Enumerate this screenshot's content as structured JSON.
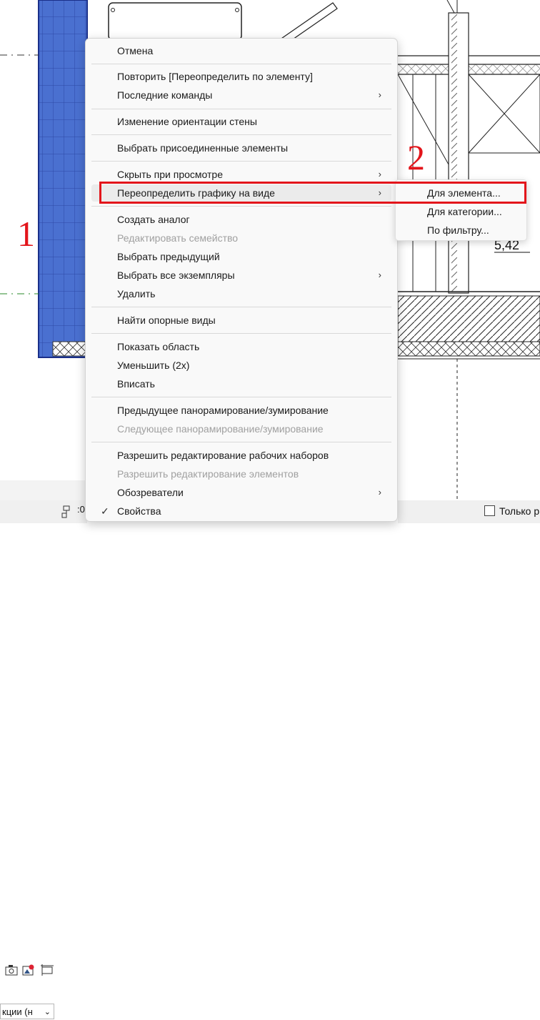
{
  "context_menu": {
    "items": [
      {
        "label": "Отмена",
        "enabled": true
      },
      {
        "label": "Повторить [Переопределить по элементу]",
        "enabled": true
      },
      {
        "label": "Последние команды",
        "enabled": true,
        "submenu": true
      },
      {
        "label": "Изменение ориентации стены",
        "enabled": true
      },
      {
        "label": "Выбрать присоединенные элементы",
        "enabled": true
      },
      {
        "label": "Скрыть при просмотре",
        "enabled": true,
        "submenu": true
      },
      {
        "label": "Переопределить графику на виде",
        "enabled": true,
        "submenu": true,
        "highlighted": true
      },
      {
        "label": "Создать аналог",
        "enabled": true
      },
      {
        "label": "Редактировать семейство",
        "enabled": false
      },
      {
        "label": "Выбрать предыдущий",
        "enabled": true
      },
      {
        "label": "Выбрать все экземпляры",
        "enabled": true,
        "submenu": true
      },
      {
        "label": "Удалить",
        "enabled": true
      },
      {
        "label": "Найти опорные виды",
        "enabled": true
      },
      {
        "label": "Показать область",
        "enabled": true
      },
      {
        "label": "Уменьшить (2x)",
        "enabled": true
      },
      {
        "label": "Вписать",
        "enabled": true
      },
      {
        "label": "Предыдущее панорамирование/зумирование",
        "enabled": true
      },
      {
        "label": "Следующее панорамирование/зумирование",
        "enabled": false
      },
      {
        "label": "Разрешить редактирование рабочих наборов",
        "enabled": true
      },
      {
        "label": "Разрешить редактирование элементов",
        "enabled": false
      },
      {
        "label": "Обозреватели",
        "enabled": true,
        "submenu": true
      },
      {
        "label": "Свойства",
        "enabled": true,
        "checked": true
      }
    ],
    "submenu_arrow": "›",
    "check_glyph": "✓"
  },
  "submenu": {
    "items": [
      {
        "label": "Для элемента..."
      },
      {
        "label": "Для категории..."
      },
      {
        "label": "По фильтру..."
      }
    ]
  },
  "annotations": {
    "label_1": "1",
    "label_2": "2",
    "color": "#e3151b"
  },
  "drawing": {
    "dimension_text": "5,42",
    "selected_wall_color": "#4a70d0"
  },
  "status_bar": {
    "combo_value": "кции (н",
    "combo_chevron": "⌄",
    "coord_text": ":0",
    "checkbox_label": "Только р"
  }
}
